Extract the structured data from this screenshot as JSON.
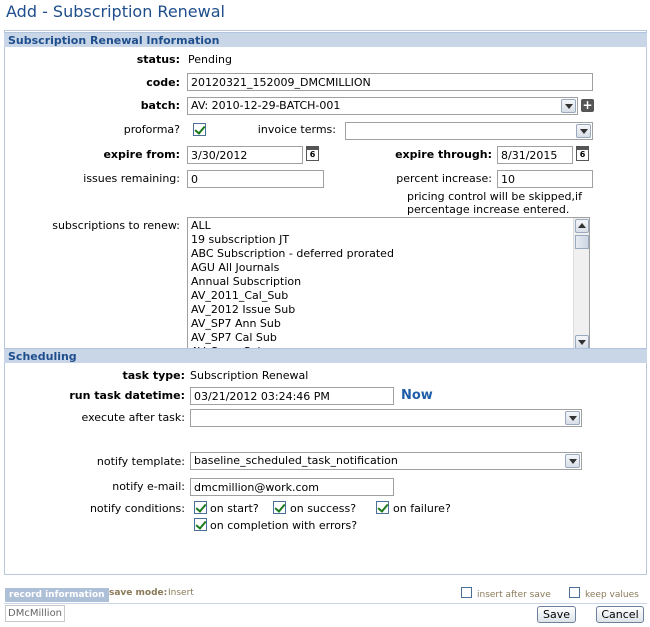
{
  "page": {
    "title": "Add - Subscription Renewal"
  },
  "sections": {
    "info": "Subscription Renewal Information",
    "scheduling": "Scheduling"
  },
  "fields": {
    "status_label": "status:",
    "status_value": "Pending",
    "code_label": "code:",
    "code_value": "20120321_152009_DMCMILLION",
    "batch_label": "batch:",
    "batch_value": "AV: 2010-12-29-BATCH-001",
    "proforma_label": "proforma?",
    "proforma_checked": true,
    "invoice_terms_label": "invoice terms:",
    "invoice_terms_value": "",
    "expire_from_label": "expire from:",
    "expire_from_value": "3/30/2012",
    "expire_through_label": "expire through:",
    "expire_through_value": "8/31/2015",
    "issues_remaining_label": "issues remaining:",
    "issues_remaining_value": "0",
    "percent_increase_label": "percent increase:",
    "percent_increase_value": "10",
    "pricing_note_line1": "pricing control will be skipped,if",
    "pricing_note_line2": "percentage increase entered.",
    "subscriptions_label": "subscriptions to renew:",
    "subscriptions": [
      "ALL",
      "19 subscription JT",
      "ABC Subscription - deferred prorated",
      "AGU All Journals",
      "Annual Subscription",
      "AV_2011_Cal_Sub",
      "AV_2012 Issue Sub",
      "AV_SP7 Ann Sub",
      "AV_SP7 Cal Sub",
      "AV_Sxpo_Sub"
    ]
  },
  "scheduling": {
    "task_type_label": "task type:",
    "task_type_value": "Subscription Renewal",
    "run_datetime_label": "run task datetime:",
    "run_datetime_value": "03/21/2012 03:24:46 PM",
    "now_link": "Now",
    "execute_after_label": "execute after task:",
    "execute_after_value": "",
    "notify_template_label": "notify template:",
    "notify_template_value": "baseline_scheduled_task_notification",
    "notify_email_label": "notify e-mail:",
    "notify_email_value": "dmcmillion@work.com",
    "notify_conditions_label": "notify conditions:",
    "cond_start": "on start?",
    "cond_success": "on success?",
    "cond_failure": "on failure?",
    "cond_errors": "on completion with errors?"
  },
  "footer": {
    "record_info": "record information",
    "save_mode_label": "save mode:",
    "save_mode_value": "Insert",
    "insert_after_save": "insert after save",
    "keep_values": "keep values",
    "user": "DMcMillion",
    "save_button": "Save",
    "cancel_button": "Cancel"
  },
  "icons": {
    "calendar": "calendar-icon",
    "add": "plus-icon",
    "dropdown": "chevron-down-icon"
  },
  "colors": {
    "title": "#1f4e8c",
    "section_bg": "#c8d6e8",
    "link": "#1f5fa8"
  }
}
